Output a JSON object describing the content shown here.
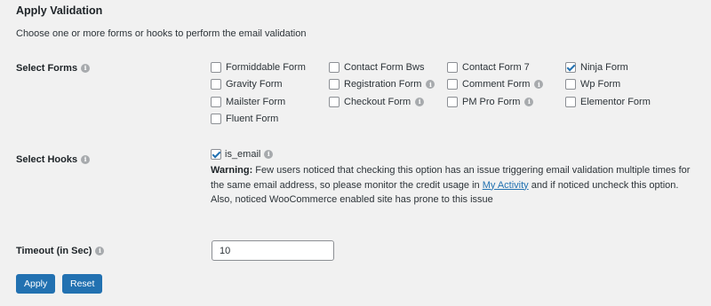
{
  "section": {
    "title": "Apply Validation",
    "description": "Choose one or more forms or hooks to perform the email validation"
  },
  "select_forms": {
    "label": "Select Forms",
    "items": [
      {
        "label": "Formiddable Form",
        "checked": false,
        "info": false
      },
      {
        "label": "Contact Form Bws",
        "checked": false,
        "info": false
      },
      {
        "label": "Contact Form 7",
        "checked": false,
        "info": false
      },
      {
        "label": "Ninja Form",
        "checked": true,
        "info": false
      },
      {
        "label": "Gravity Form",
        "checked": false,
        "info": false
      },
      {
        "label": "Registration Form",
        "checked": false,
        "info": true
      },
      {
        "label": "Comment Form",
        "checked": false,
        "info": true
      },
      {
        "label": "Wp Form",
        "checked": false,
        "info": false
      },
      {
        "label": "Mailster Form",
        "checked": false,
        "info": false
      },
      {
        "label": "Checkout Form",
        "checked": false,
        "info": true
      },
      {
        "label": "PM Pro Form",
        "checked": false,
        "info": true
      },
      {
        "label": "Elementor Form",
        "checked": false,
        "info": false
      },
      {
        "label": "Fluent Form",
        "checked": false,
        "info": false
      }
    ]
  },
  "select_hooks": {
    "label": "Select Hooks",
    "hook_label": "is_email",
    "hook_checked": true,
    "warning_title": "Warning:",
    "warning_before": " Few users noticed that checking this option has an issue triggering email validation multiple times for the same email address, so please monitor the credit usage in ",
    "warning_link": "My Activity",
    "warning_after": " and if noticed uncheck this option. Also, noticed WooCommerce enabled site has prone to this issue"
  },
  "timeout": {
    "label": "Timeout (in Sec)",
    "value": "10"
  },
  "buttons": {
    "apply": "Apply",
    "reset": "Reset"
  },
  "icons": {
    "info": "info-icon",
    "info_glyph": "i"
  },
  "colors": {
    "accent": "#2271b1",
    "background": "#f1f1f1"
  }
}
